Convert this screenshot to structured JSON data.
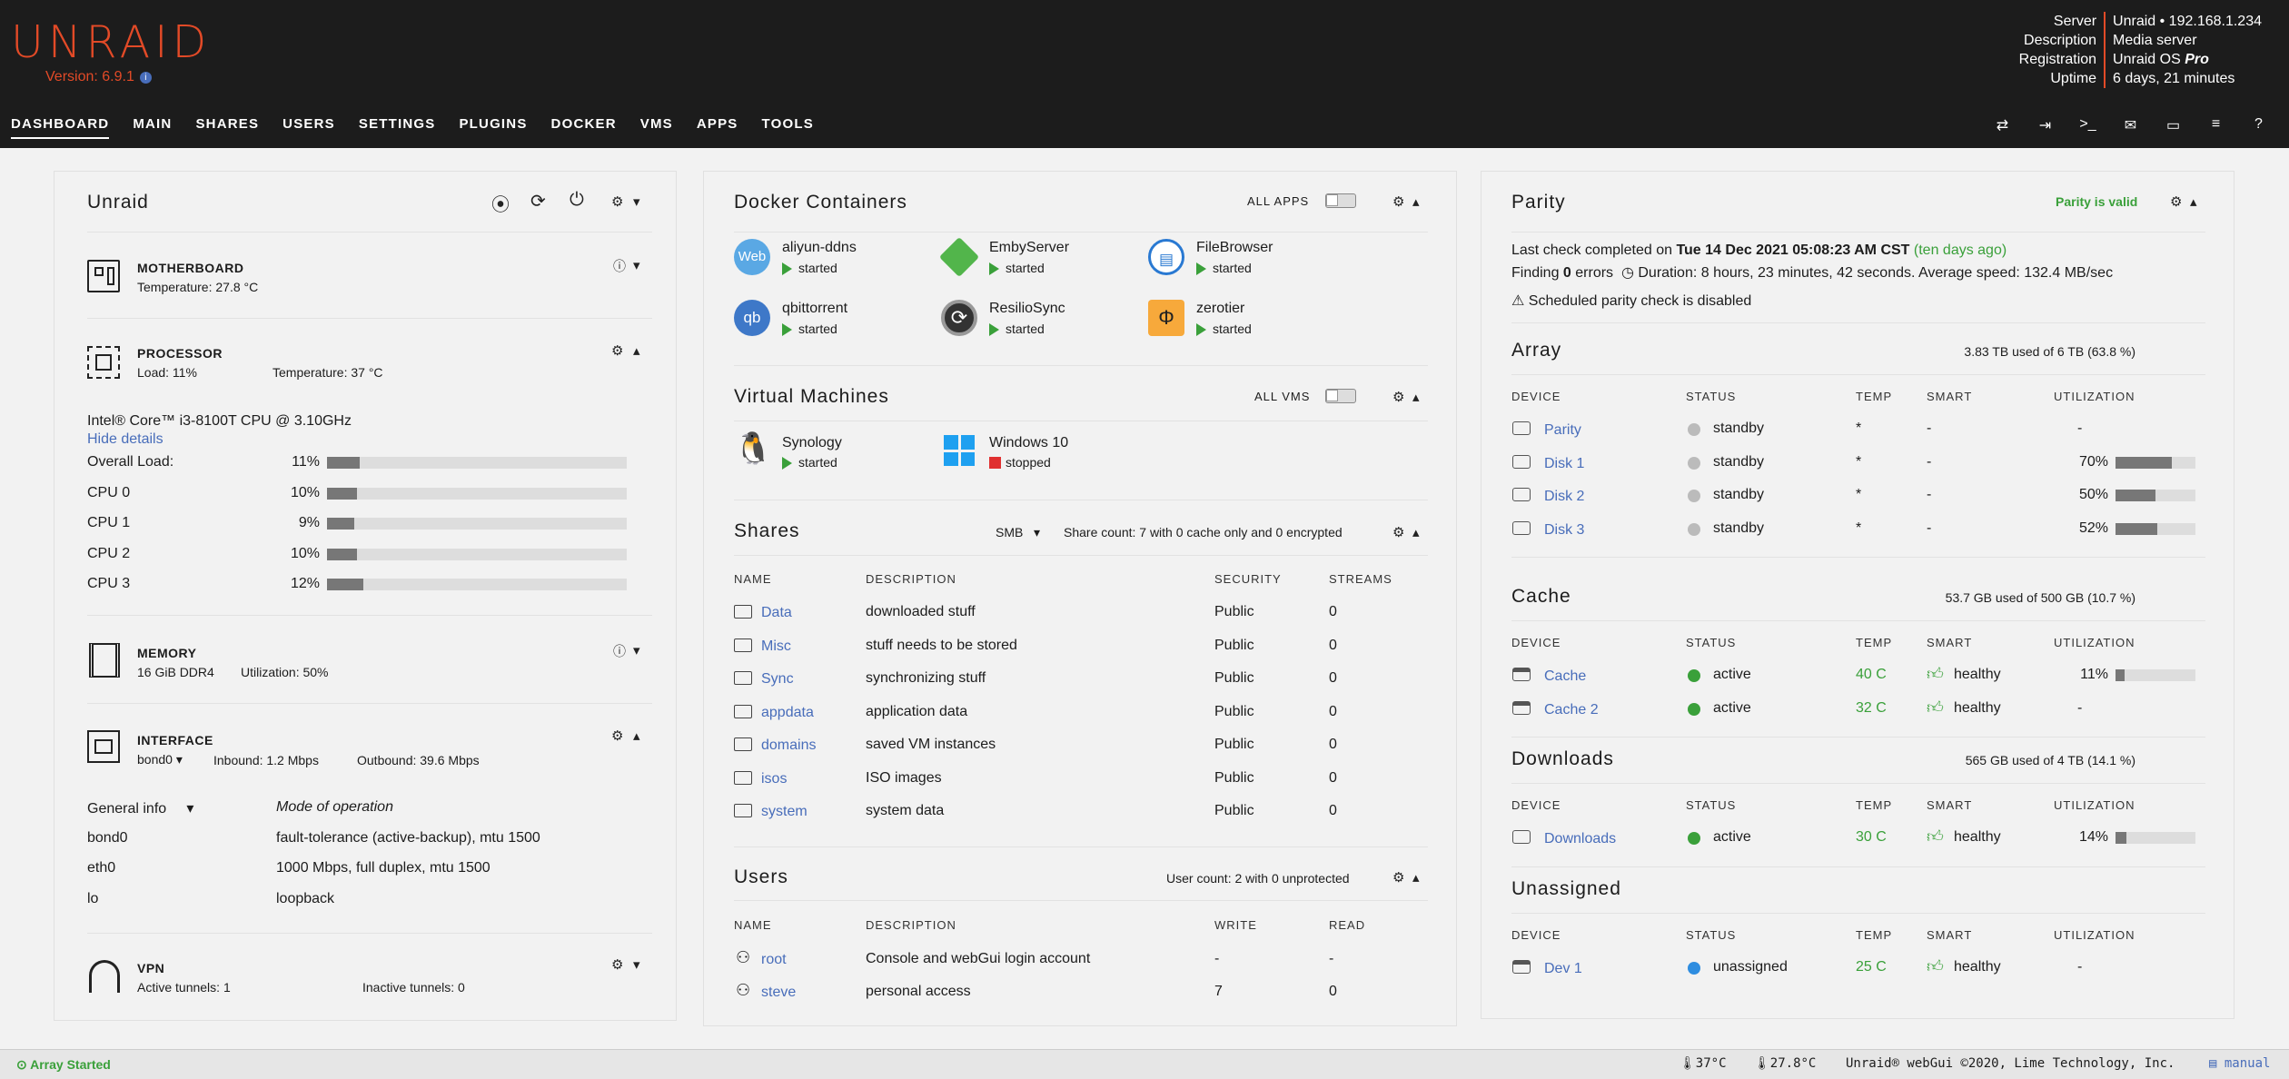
{
  "header": {
    "logo": "UNRAID",
    "version": "Version: 6.9.1",
    "version_info_icon": "info-icon",
    "server_labels": [
      "Server",
      "Description",
      "Registration",
      "Uptime"
    ],
    "server": "Unraid • 192.168.1.234",
    "description": "Media server",
    "registration": "Unraid OS ",
    "registration_em": "Pro",
    "uptime": "6 days, 21 minutes"
  },
  "nav": [
    "DASHBOARD",
    "MAIN",
    "SHARES",
    "USERS",
    "SETTINGS",
    "PLUGINS",
    "DOCKER",
    "VMS",
    "APPS",
    "TOOLS"
  ],
  "toolbar_icons": [
    "switch-icon",
    "logout-icon",
    "terminal-icon",
    "feedback-icon",
    "monitor-icon",
    "log-icon",
    "help-icon"
  ],
  "unraid": {
    "title": "Unraid",
    "motherboard": {
      "title": "MOTHERBOARD",
      "temp": "Temperature: 27.8 °C"
    },
    "processor": {
      "title": "PROCESSOR",
      "load": "Load: 11%",
      "temp": "Temperature: 37 °C",
      "cpu": "Intel® Core™ i3-8100T CPU @ 3.10GHz",
      "hide": "Hide details",
      "rows": [
        {
          "label": "Overall Load:",
          "pct": "11%",
          "v": 0.11
        },
        {
          "label": "CPU 0",
          "pct": "10%",
          "v": 0.1
        },
        {
          "label": "CPU 1",
          "pct": "9%",
          "v": 0.09
        },
        {
          "label": "CPU 2",
          "pct": "10%",
          "v": 0.1
        },
        {
          "label": "CPU 3",
          "pct": "12%",
          "v": 0.12
        }
      ]
    },
    "memory": {
      "title": "MEMORY",
      "size": "16 GiB DDR4",
      "util": "Utilization: 50%"
    },
    "interface": {
      "title": "INTERFACE",
      "iface": "bond0",
      "inbound": "Inbound: 1.2 Mbps",
      "outbound": "Outbound: 39.6 Mbps",
      "info": "General info",
      "mode": "Mode of operation",
      "rows": [
        {
          "n": "bond0",
          "v": "fault-tolerance (active-backup), mtu 1500"
        },
        {
          "n": "eth0",
          "v": "1000 Mbps, full duplex, mtu 1500"
        },
        {
          "n": "lo",
          "v": "loopback"
        }
      ]
    },
    "vpn": {
      "title": "VPN",
      "active": "Active tunnels: 1",
      "inactive": "Inactive tunnels: 0"
    }
  },
  "docker": {
    "title": "Docker Containers",
    "all": "ALL APPS",
    "items": [
      {
        "n": "aliyun-ddns",
        "s": "started",
        "icon": "Web"
      },
      {
        "n": "EmbyServer",
        "s": "started",
        "icon": "emby-icon"
      },
      {
        "n": "FileBrowser",
        "s": "started",
        "icon": "filebrowser-icon"
      },
      {
        "n": "qbittorrent",
        "s": "started",
        "icon": "qb"
      },
      {
        "n": "ResilioSync",
        "s": "started",
        "icon": "resilio-icon"
      },
      {
        "n": "zerotier",
        "s": "started",
        "icon": "zerotier-icon"
      }
    ]
  },
  "vms": {
    "title": "Virtual Machines",
    "all": "ALL VMS",
    "items": [
      {
        "n": "Synology",
        "s": "started"
      },
      {
        "n": "Windows 10",
        "s": "stopped"
      }
    ]
  },
  "shares": {
    "title": "Shares",
    "proto": "SMB",
    "count": "Share count: 7 with 0 cache only and 0 encrypted",
    "cols": [
      "NAME",
      "DESCRIPTION",
      "SECURITY",
      "STREAMS"
    ],
    "rows": [
      {
        "n": "Data",
        "d": "downloaded stuff",
        "s": "Public",
        "c": "0"
      },
      {
        "n": "Misc",
        "d": "stuff needs to be stored",
        "s": "Public",
        "c": "0"
      },
      {
        "n": "Sync",
        "d": "synchronizing stuff",
        "s": "Public",
        "c": "0"
      },
      {
        "n": "appdata",
        "d": "application data",
        "s": "Public",
        "c": "0"
      },
      {
        "n": "domains",
        "d": "saved VM instances",
        "s": "Public",
        "c": "0"
      },
      {
        "n": "isos",
        "d": "ISO images",
        "s": "Public",
        "c": "0"
      },
      {
        "n": "system",
        "d": "system data",
        "s": "Public",
        "c": "0"
      }
    ]
  },
  "users": {
    "title": "Users",
    "count": "User count: 2 with 0 unprotected",
    "cols": [
      "NAME",
      "DESCRIPTION",
      "WRITE",
      "READ"
    ],
    "rows": [
      {
        "n": "root",
        "d": "Console and webGui login account",
        "w": "-",
        "r": "-"
      },
      {
        "n": "steve",
        "d": "personal access",
        "w": "7",
        "r": "0"
      }
    ]
  },
  "parity": {
    "title": "Parity",
    "valid": "Parity is valid",
    "last_pre": "Last check completed on ",
    "last_date": "Tue 14 Dec 2021 05:08:23 AM CST",
    "last_ago": " (ten days ago)",
    "finding_pre": "Finding ",
    "finding_b": "0",
    "finding_post": " errors",
    "duration": "Duration: 8 hours, 23 minutes, 42 seconds. Average speed: 132.4 MB/sec",
    "sched": "Scheduled parity check is disabled"
  },
  "cols": [
    "DEVICE",
    "STATUS",
    "TEMP",
    "SMART",
    "UTILIZATION"
  ],
  "array": {
    "title": "Array",
    "used": "3.83 TB used of 6 TB (63.8 %)",
    "rows": [
      {
        "d": "Parity",
        "s": "standby",
        "t": "*",
        "m": "-",
        "u": "-",
        "v": null
      },
      {
        "d": "Disk 1",
        "s": "standby",
        "t": "*",
        "m": "-",
        "u": "70%",
        "v": 0.7
      },
      {
        "d": "Disk 2",
        "s": "standby",
        "t": "*",
        "m": "-",
        "u": "50%",
        "v": 0.5
      },
      {
        "d": "Disk 3",
        "s": "standby",
        "t": "*",
        "m": "-",
        "u": "52%",
        "v": 0.52
      }
    ]
  },
  "cache": {
    "title": "Cache",
    "used": "53.7 GB used of 500 GB (10.7 %)",
    "rows": [
      {
        "d": "Cache",
        "s": "active",
        "t": "40 C",
        "m": "healthy",
        "u": "11%",
        "v": 0.11
      },
      {
        "d": "Cache 2",
        "s": "active",
        "t": "32 C",
        "m": "healthy",
        "u": "-",
        "v": null
      }
    ]
  },
  "downloads": {
    "title": "Downloads",
    "used": "565 GB used of 4 TB (14.1 %)",
    "rows": [
      {
        "d": "Downloads",
        "s": "active",
        "t": "30 C",
        "m": "healthy",
        "u": "14%",
        "v": 0.14
      }
    ]
  },
  "unassigned": {
    "title": "Unassigned",
    "rows": [
      {
        "d": "Dev 1",
        "s": "unassigned",
        "t": "25 C",
        "m": "healthy",
        "u": "-"
      }
    ]
  },
  "footer": {
    "status": "Array Started",
    "t1": "37°C",
    "t2": "27.8°C",
    "copy": "Unraid® webGui ©2020, Lime Technology, Inc.",
    "manual": "manual"
  }
}
